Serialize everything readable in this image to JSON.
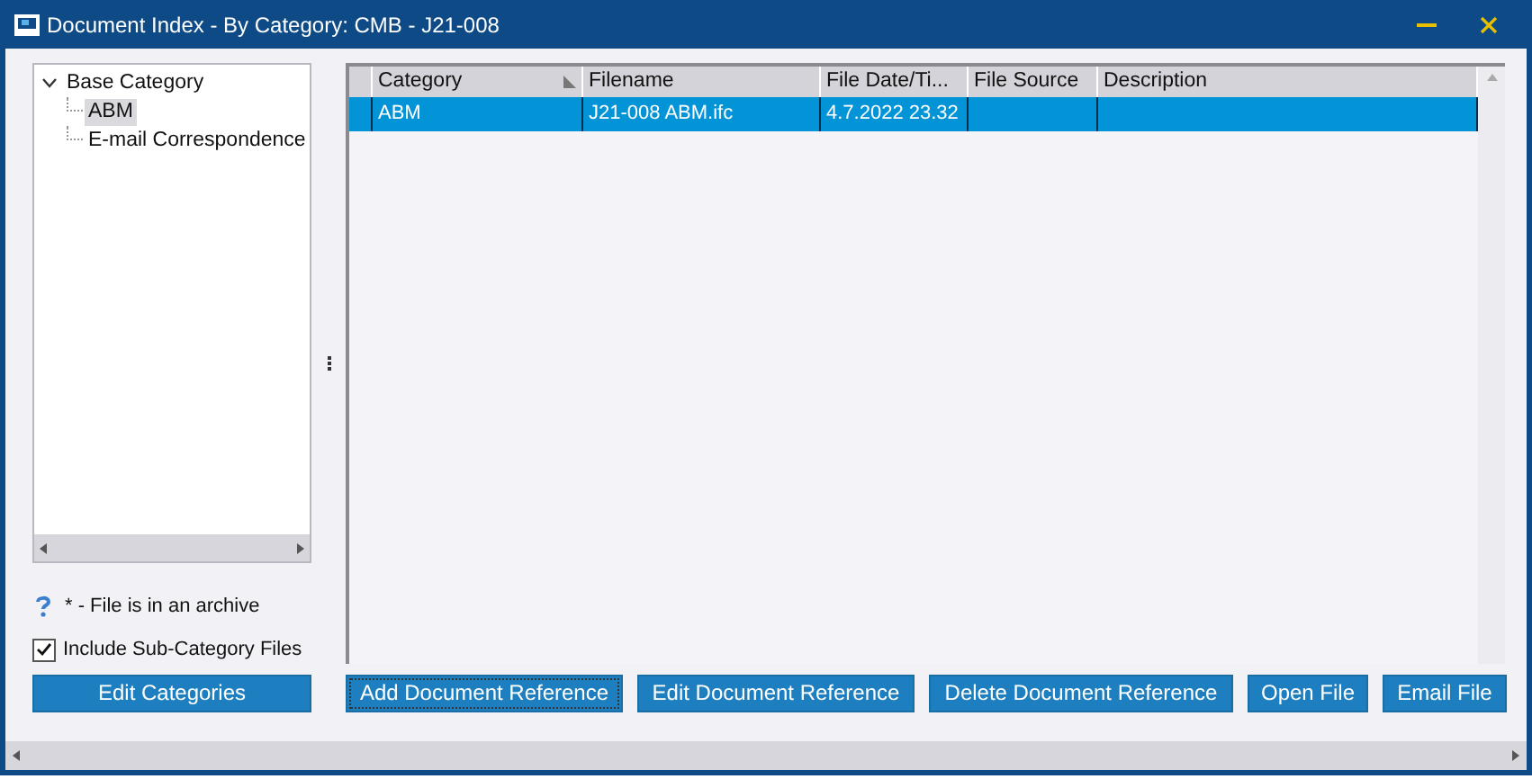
{
  "window": {
    "title": "Document Index - By Category: CMB - J21-008"
  },
  "tree": [
    {
      "label": "Base Category",
      "expanded": true,
      "selected": false,
      "children": [
        {
          "label": "ABM",
          "selected": true
        },
        {
          "label": "E-mail Correspondence",
          "selected": false
        }
      ]
    }
  ],
  "legend": "* - File is in an archive",
  "include_subcategories": {
    "label": "Include Sub-Category Files",
    "checked": true
  },
  "table": {
    "columns": [
      "Category",
      "Filename",
      "File Date/Ti...",
      "File Source",
      "Description"
    ],
    "rows": [
      {
        "selected": true,
        "cells": [
          "ABM",
          "J21-008 ABM.ifc",
          "4.7.2022 23.32"
        ]
      }
    ]
  },
  "left_button": "Edit Categories",
  "buttons": [
    {
      "label": "Add Document Reference",
      "focused": true
    },
    {
      "label": "Edit Document Reference",
      "focused": false
    },
    {
      "label": "Delete Document Reference",
      "focused": false
    },
    {
      "label": "Open File",
      "focused": false
    },
    {
      "label": "Email File",
      "focused": false
    }
  ]
}
